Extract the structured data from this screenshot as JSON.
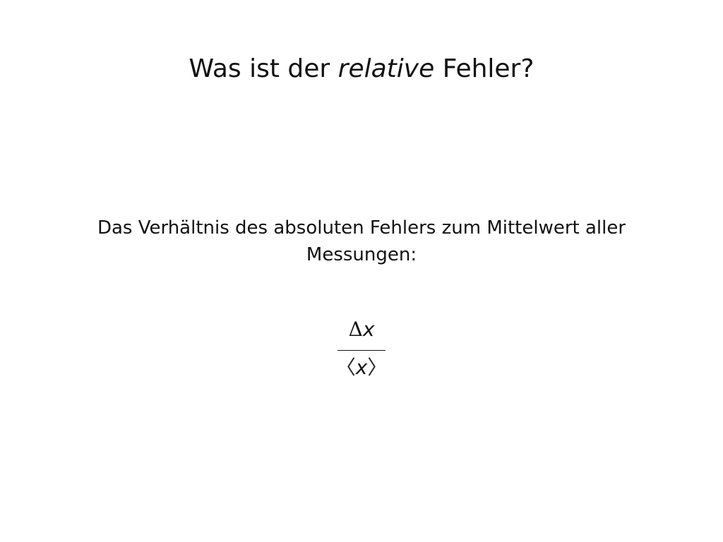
{
  "slide": {
    "title": {
      "before": "Was ist der",
      "emphasis": "relative",
      "after": "Fehler?"
    },
    "body": {
      "line1": "Das Verhältnis des absoluten Fehlers zum Mittelwert aller",
      "line2": "Messungen:"
    },
    "formula": {
      "numerator_symbol": "Δ",
      "numerator_variable": "x",
      "denominator_left_bracket": "〈",
      "denominator_variable": "x",
      "denominator_right_bracket": "〉"
    }
  }
}
